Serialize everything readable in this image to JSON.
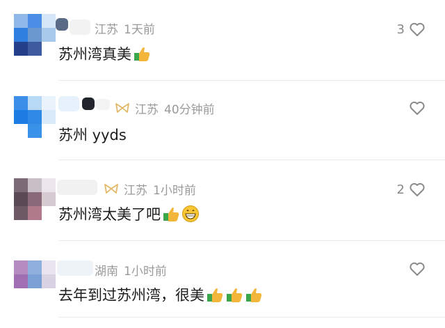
{
  "comments": [
    {
      "location": "江苏",
      "time": "1天前",
      "text": "苏州湾真美",
      "likes": "3",
      "emojis": [
        "thumbs-up-emoji"
      ],
      "has_badge": false
    },
    {
      "location": "江苏",
      "time": "40分钟前",
      "text": "苏州 yyds",
      "likes": "",
      "emojis": [],
      "has_badge": true
    },
    {
      "location": "江苏",
      "time": "1小时前",
      "text": "苏州湾太美了吧",
      "likes": "2",
      "emojis": [
        "thumbs-up-emoji",
        "grinning-face-emoji"
      ],
      "has_badge": true
    },
    {
      "location": "湖南",
      "time": "1小时前",
      "text": "去年到过苏州湾，很美",
      "likes": "",
      "emojis": [
        "thumbs-up-emoji",
        "thumbs-up-emoji",
        "thumbs-up-emoji"
      ],
      "has_badge": false
    }
  ],
  "colors": {
    "text": "#1d1d1d",
    "meta": "#9a9a9a",
    "badge": "#e2b868",
    "heart": "#8a8a8a"
  }
}
